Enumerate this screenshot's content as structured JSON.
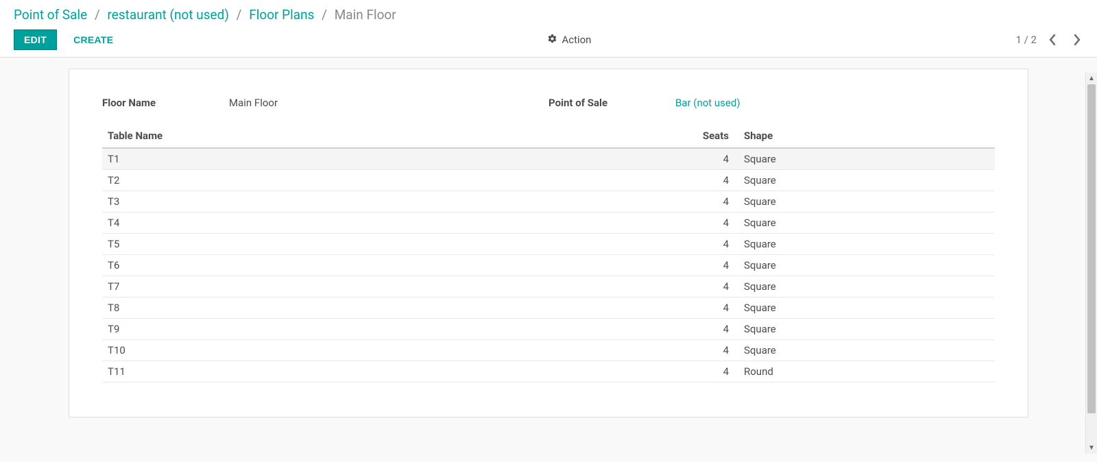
{
  "breadcrumbs": {
    "items": [
      {
        "label": "Point of Sale",
        "link": true
      },
      {
        "label": "restaurant (not used)",
        "link": true
      },
      {
        "label": "Floor Plans",
        "link": true
      },
      {
        "label": "Main Floor",
        "link": false
      }
    ],
    "separator": "/"
  },
  "toolbar": {
    "edit_label": "EDIT",
    "create_label": "CREATE",
    "action_label": "Action",
    "pager": "1 / 2"
  },
  "form": {
    "floor_name_label": "Floor Name",
    "floor_name_value": "Main Floor",
    "pos_label": "Point of Sale",
    "pos_value": "Bar (not used)"
  },
  "table": {
    "headers": {
      "name": "Table Name",
      "seats": "Seats",
      "shape": "Shape"
    },
    "rows": [
      {
        "name": "T1",
        "seats": "4",
        "shape": "Square"
      },
      {
        "name": "T2",
        "seats": "4",
        "shape": "Square"
      },
      {
        "name": "T3",
        "seats": "4",
        "shape": "Square"
      },
      {
        "name": "T4",
        "seats": "4",
        "shape": "Square"
      },
      {
        "name": "T5",
        "seats": "4",
        "shape": "Square"
      },
      {
        "name": "T6",
        "seats": "4",
        "shape": "Square"
      },
      {
        "name": "T7",
        "seats": "4",
        "shape": "Square"
      },
      {
        "name": "T8",
        "seats": "4",
        "shape": "Square"
      },
      {
        "name": "T9",
        "seats": "4",
        "shape": "Square"
      },
      {
        "name": "T10",
        "seats": "4",
        "shape": "Square"
      },
      {
        "name": "T11",
        "seats": "4",
        "shape": "Round"
      }
    ]
  }
}
